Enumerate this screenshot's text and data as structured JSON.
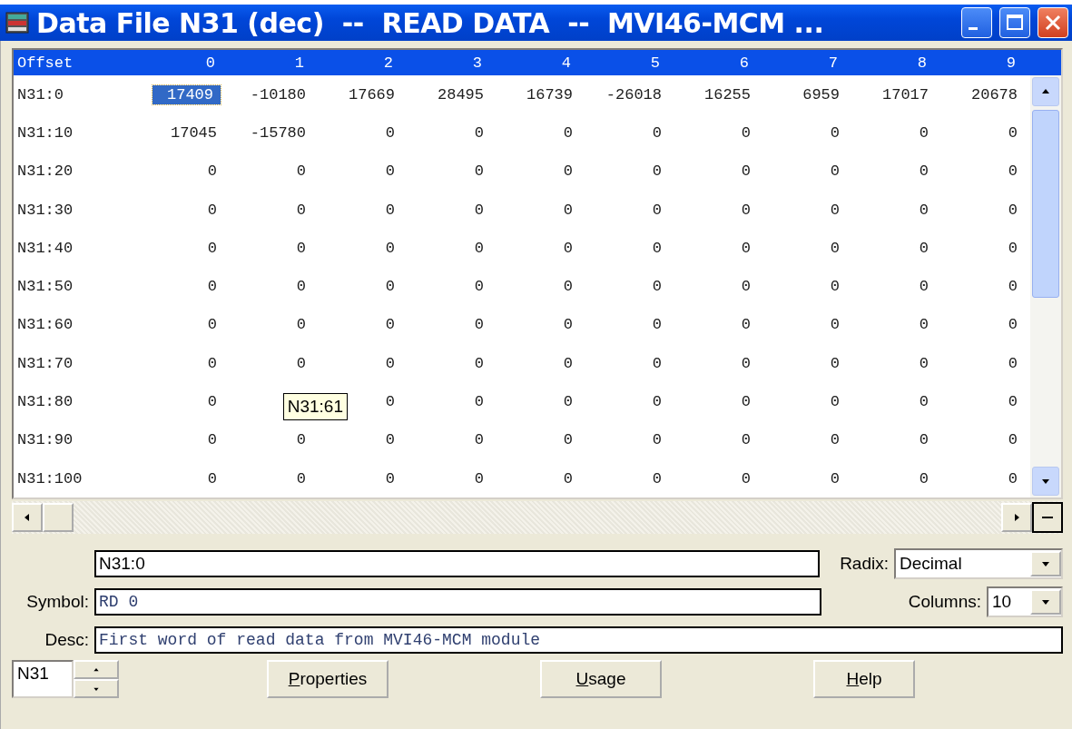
{
  "window": {
    "title": "Data File N31 (dec)  --  READ DATA  --  MVI46-MCM ..."
  },
  "table": {
    "row_header": "Offset",
    "columns": [
      "0",
      "1",
      "2",
      "3",
      "4",
      "5",
      "6",
      "7",
      "8",
      "9"
    ],
    "rows": [
      {
        "label": "N31:0",
        "cells": [
          {
            "value": "17409",
            "selected": true
          },
          {
            "value": "-10180",
            "selected": false
          },
          {
            "value": "17669",
            "selected": false
          },
          {
            "value": "28495",
            "selected": false
          },
          {
            "value": "16739",
            "selected": false
          },
          {
            "value": "-26018",
            "selected": false
          },
          {
            "value": "16255",
            "selected": false
          },
          {
            "value": "6959",
            "selected": false
          },
          {
            "value": "17017",
            "selected": false
          },
          {
            "value": "20678",
            "selected": false
          }
        ]
      },
      {
        "label": "N31:10",
        "cells": [
          {
            "value": "17045",
            "selected": false
          },
          {
            "value": "-15780",
            "selected": false
          },
          {
            "value": "0",
            "selected": false
          },
          {
            "value": "0",
            "selected": false
          },
          {
            "value": "0",
            "selected": false
          },
          {
            "value": "0",
            "selected": false
          },
          {
            "value": "0",
            "selected": false
          },
          {
            "value": "0",
            "selected": false
          },
          {
            "value": "0",
            "selected": false
          },
          {
            "value": "0",
            "selected": false
          }
        ]
      },
      {
        "label": "N31:20",
        "cells": [
          {
            "value": "0",
            "selected": false
          },
          {
            "value": "0",
            "selected": false
          },
          {
            "value": "0",
            "selected": false
          },
          {
            "value": "0",
            "selected": false
          },
          {
            "value": "0",
            "selected": false
          },
          {
            "value": "0",
            "selected": false
          },
          {
            "value": "0",
            "selected": false
          },
          {
            "value": "0",
            "selected": false
          },
          {
            "value": "0",
            "selected": false
          },
          {
            "value": "0",
            "selected": false
          }
        ]
      },
      {
        "label": "N31:30",
        "cells": [
          {
            "value": "0",
            "selected": false
          },
          {
            "value": "0",
            "selected": false
          },
          {
            "value": "0",
            "selected": false
          },
          {
            "value": "0",
            "selected": false
          },
          {
            "value": "0",
            "selected": false
          },
          {
            "value": "0",
            "selected": false
          },
          {
            "value": "0",
            "selected": false
          },
          {
            "value": "0",
            "selected": false
          },
          {
            "value": "0",
            "selected": false
          },
          {
            "value": "0",
            "selected": false
          }
        ]
      },
      {
        "label": "N31:40",
        "cells": [
          {
            "value": "0",
            "selected": false
          },
          {
            "value": "0",
            "selected": false
          },
          {
            "value": "0",
            "selected": false
          },
          {
            "value": "0",
            "selected": false
          },
          {
            "value": "0",
            "selected": false
          },
          {
            "value": "0",
            "selected": false
          },
          {
            "value": "0",
            "selected": false
          },
          {
            "value": "0",
            "selected": false
          },
          {
            "value": "0",
            "selected": false
          },
          {
            "value": "0",
            "selected": false
          }
        ]
      },
      {
        "label": "N31:50",
        "cells": [
          {
            "value": "0",
            "selected": false
          },
          {
            "value": "0",
            "selected": false
          },
          {
            "value": "0",
            "selected": false
          },
          {
            "value": "0",
            "selected": false
          },
          {
            "value": "0",
            "selected": false
          },
          {
            "value": "0",
            "selected": false
          },
          {
            "value": "0",
            "selected": false
          },
          {
            "value": "0",
            "selected": false
          },
          {
            "value": "0",
            "selected": false
          },
          {
            "value": "0",
            "selected": false
          }
        ]
      },
      {
        "label": "N31:60",
        "cells": [
          {
            "value": "0",
            "selected": false
          },
          {
            "value": "0",
            "selected": false
          },
          {
            "value": "0",
            "selected": false
          },
          {
            "value": "0",
            "selected": false
          },
          {
            "value": "0",
            "selected": false
          },
          {
            "value": "0",
            "selected": false
          },
          {
            "value": "0",
            "selected": false
          },
          {
            "value": "0",
            "selected": false
          },
          {
            "value": "0",
            "selected": false
          },
          {
            "value": "0",
            "selected": false
          }
        ]
      },
      {
        "label": "N31:70",
        "cells": [
          {
            "value": "0",
            "selected": false
          },
          {
            "value": "0",
            "selected": false
          },
          {
            "value": "0",
            "selected": false
          },
          {
            "value": "0",
            "selected": false
          },
          {
            "value": "0",
            "selected": false
          },
          {
            "value": "0",
            "selected": false
          },
          {
            "value": "0",
            "selected": false
          },
          {
            "value": "0",
            "selected": false
          },
          {
            "value": "0",
            "selected": false
          },
          {
            "value": "0",
            "selected": false
          }
        ]
      },
      {
        "label": "N31:80",
        "cells": [
          {
            "value": "0",
            "selected": false
          },
          {
            "tooltip": "N31:61"
          },
          {
            "value": "0",
            "selected": false
          },
          {
            "value": "0",
            "selected": false
          },
          {
            "value": "0",
            "selected": false
          },
          {
            "value": "0",
            "selected": false
          },
          {
            "value": "0",
            "selected": false
          },
          {
            "value": "0",
            "selected": false
          },
          {
            "value": "0",
            "selected": false
          },
          {
            "value": "0",
            "selected": false
          }
        ]
      },
      {
        "label": "N31:90",
        "cells": [
          {
            "value": "0",
            "selected": false
          },
          {
            "value": "0",
            "selected": false
          },
          {
            "value": "0",
            "selected": false
          },
          {
            "value": "0",
            "selected": false
          },
          {
            "value": "0",
            "selected": false
          },
          {
            "value": "0",
            "selected": false
          },
          {
            "value": "0",
            "selected": false
          },
          {
            "value": "0",
            "selected": false
          },
          {
            "value": "0",
            "selected": false
          },
          {
            "value": "0",
            "selected": false
          }
        ]
      },
      {
        "label": "N31:100",
        "cells": [
          {
            "value": "0",
            "selected": false
          },
          {
            "value": "0",
            "selected": false
          },
          {
            "value": "0",
            "selected": false
          },
          {
            "value": "0",
            "selected": false
          },
          {
            "value": "0",
            "selected": false
          },
          {
            "value": "0",
            "selected": false
          },
          {
            "value": "0",
            "selected": false
          },
          {
            "value": "0",
            "selected": false
          },
          {
            "value": "0",
            "selected": false
          },
          {
            "value": "0",
            "selected": false
          }
        ]
      }
    ]
  },
  "address": {
    "value": "N31:0"
  },
  "radix": {
    "label": "Radix:",
    "value": "Decimal"
  },
  "symbol": {
    "label": "Symbol:",
    "value": "RD 0"
  },
  "columns_select": {
    "label": "Columns:",
    "value": "10"
  },
  "desc": {
    "label": "Desc:",
    "value": "First word of read data from MVI46-MCM module"
  },
  "file_spinner": {
    "value": "N31"
  },
  "buttons": [
    "Properties",
    "Usage",
    "Help"
  ]
}
